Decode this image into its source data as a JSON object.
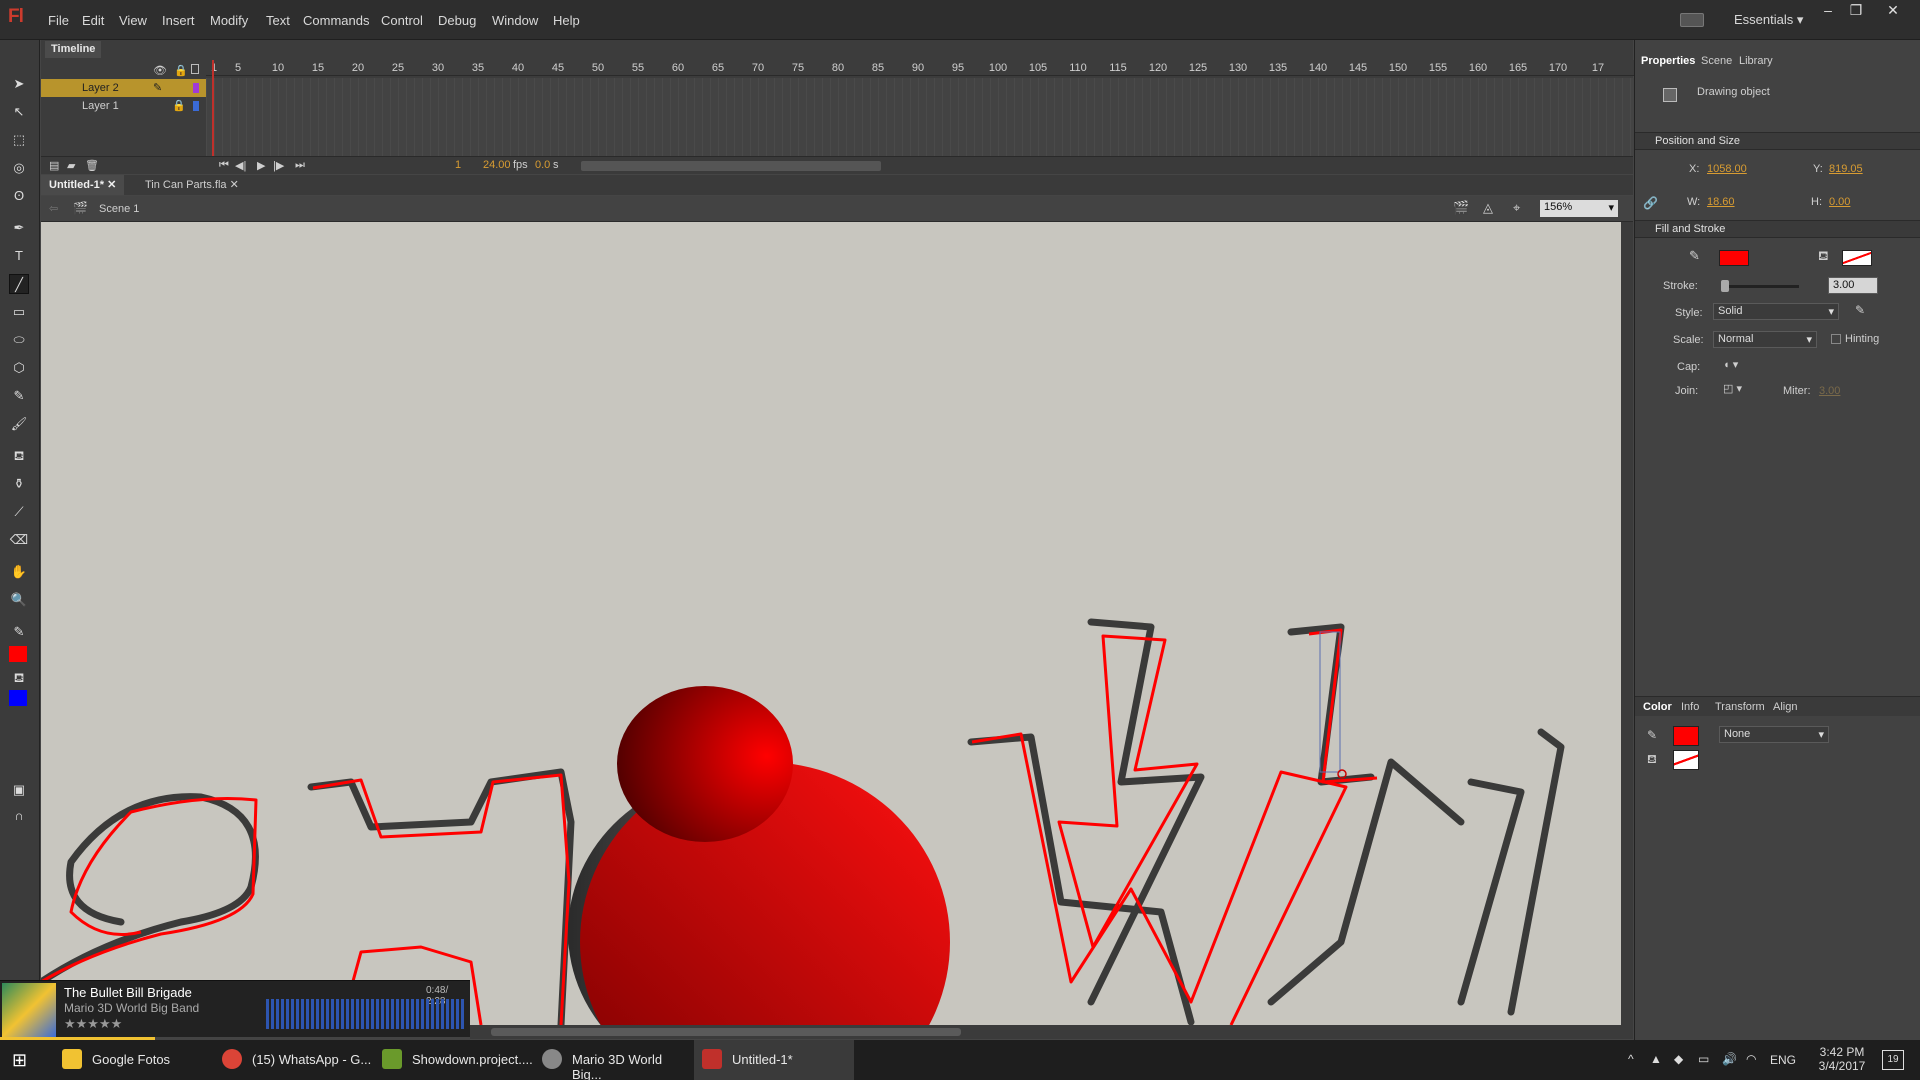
{
  "app": {
    "logo": "Fl",
    "menu": [
      "File",
      "Edit",
      "View",
      "Insert",
      "Modify",
      "Text",
      "Commands",
      "Control",
      "Debug",
      "Window",
      "Help"
    ],
    "workspace": "Essentials"
  },
  "timeline": {
    "tab": "Timeline",
    "ruler": [
      "1",
      "5",
      "10",
      "15",
      "20",
      "25",
      "30",
      "35",
      "40",
      "45",
      "50",
      "55",
      "60",
      "65",
      "70",
      "75",
      "80",
      "85",
      "90",
      "95",
      "100",
      "105",
      "110",
      "115",
      "120",
      "125",
      "130",
      "135",
      "140",
      "145",
      "150",
      "155",
      "160",
      "165",
      "170",
      "17"
    ],
    "layers": [
      {
        "name": "Layer 2"
      },
      {
        "name": "Layer 1"
      }
    ],
    "frame": "1",
    "fps": "24.00",
    "fps_unit": "fps",
    "time": "0.0",
    "time_unit": "s"
  },
  "docs": {
    "tabs": [
      "Untitled-1*",
      "Tin Can Parts.fla"
    ],
    "scene": "Scene 1",
    "zoom": "156%"
  },
  "properties": {
    "tabs": [
      "Properties",
      "Scene",
      "Library"
    ],
    "object_type": "Drawing object",
    "pos_section": "Position and Size",
    "x_label": "X:",
    "x": "1058.00",
    "y_label": "Y:",
    "y": "819.05",
    "w_label": "W:",
    "w": "18.60",
    "h_label": "H:",
    "h": "0.00",
    "fill_section": "Fill and Stroke",
    "stroke_label": "Stroke:",
    "stroke": "3.00",
    "style_label": "Style:",
    "style": "Solid",
    "scale_label": "Scale:",
    "scale": "Normal",
    "hinting": "Hinting",
    "cap_label": "Cap:",
    "join_label": "Join:",
    "miter_label": "Miter:",
    "miter": "3.00",
    "stroke_color": "#ff0000"
  },
  "color_panel": {
    "tabs": [
      "Color",
      "Info",
      "Transform",
      "Align"
    ],
    "type": "None"
  },
  "player": {
    "title": "The Bullet Bill Brigade",
    "artist": "Mario 3D World Big Band",
    "time": "0:48/ 2:28"
  },
  "taskbar": {
    "items": [
      "Google Fotos",
      "(15) WhatsApp - G...",
      "Showdown.project....",
      "Mario 3D World Big...",
      "Untitled-1*"
    ],
    "lang": "ENG",
    "clock": "3:42 PM",
    "date": "3/4/2017",
    "badge": "19"
  }
}
